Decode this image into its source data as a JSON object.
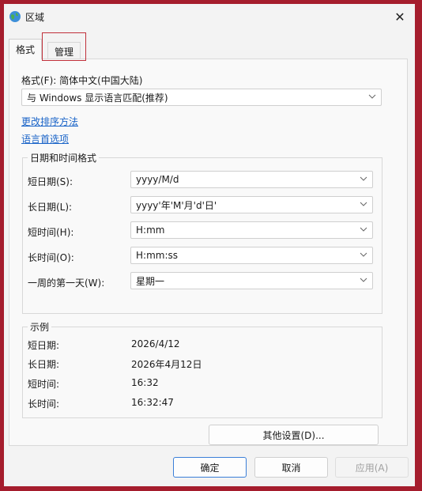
{
  "window": {
    "title": "区域"
  },
  "tabs": [
    {
      "label": "格式"
    },
    {
      "label": "管理"
    }
  ],
  "format": {
    "label": "格式(F): 简体中文(中国大陆)",
    "language_select_value": "与 Windows 显示语言匹配(推荐)"
  },
  "links": {
    "change_sort": "更改排序方法",
    "language_prefs": "语言首选项"
  },
  "datetime_group": {
    "title": "日期和时间格式",
    "rows": [
      {
        "label": "短日期(S):",
        "value": "yyyy/M/d"
      },
      {
        "label": "长日期(L):",
        "value": "yyyy'年'M'月'd'日'"
      },
      {
        "label": "短时间(H):",
        "value": "H:mm"
      },
      {
        "label": "长时间(O):",
        "value": "H:mm:ss"
      },
      {
        "label": "一周的第一天(W):",
        "value": "星期一"
      }
    ]
  },
  "example_group": {
    "title": "示例",
    "rows": [
      {
        "label": "短日期:",
        "value": "2026/4/12"
      },
      {
        "label": "长日期:",
        "value": "2026年4月12日"
      },
      {
        "label": "短时间:",
        "value": "16:32"
      },
      {
        "label": "长时间:",
        "value": "16:32:47"
      }
    ]
  },
  "buttons": {
    "additional_settings": "其他设置(D)...",
    "ok": "确定",
    "cancel": "取消",
    "apply": "应用(A)"
  },
  "icons": {
    "app": "globe-icon",
    "close": "close-icon",
    "dropdown": "chevron-down-icon"
  },
  "colors": {
    "link": "#1a64c8",
    "highlight": "#c0303a",
    "frame": "#a51d2d",
    "primary_border": "#3b7fd8"
  }
}
